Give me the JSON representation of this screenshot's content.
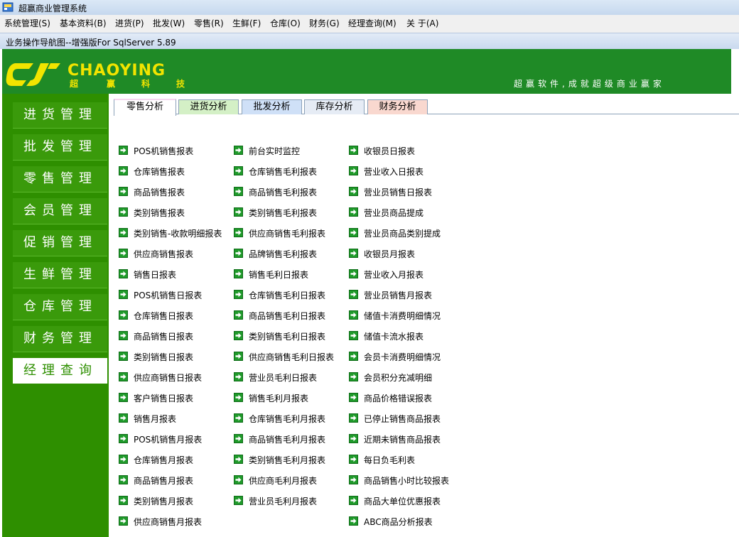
{
  "window": {
    "title": "超赢商业管理系统"
  },
  "menu": [
    "系统管理(S)",
    "基本资料(B)",
    "进货(P)",
    "批发(W)",
    "零售(R)",
    "生鲜(F)",
    "仓库(O)",
    "财务(G)",
    "经理查询(M)",
    "关 于(A)"
  ],
  "child_window": {
    "title": "业务操作导航图--增强版For SqlServer 5.89"
  },
  "banner": {
    "logo_text": "CHAOYING",
    "logo_sub": [
      "超",
      "赢",
      "科",
      "技"
    ],
    "slogan": "超赢软件,成就超级商业赢家"
  },
  "sidebar": {
    "items": [
      "进货管理",
      "批发管理",
      "零售管理",
      "会员管理",
      "促销管理",
      "生鲜管理",
      "仓库管理",
      "财务管理",
      "经理查询"
    ],
    "active_index": 8
  },
  "tabs": {
    "items": [
      {
        "label": "零售分析",
        "color": "#f7d6ef"
      },
      {
        "label": "进货分析",
        "color": "#d4f0c6"
      },
      {
        "label": "批发分析",
        "color": "#cfe0f7"
      },
      {
        "label": "库存分析",
        "color": "#e6ecf5"
      },
      {
        "label": "财务分析",
        "color": "#f9d8cf"
      }
    ],
    "active_index": 0
  },
  "reports": {
    "columns": [
      [
        "POS机销售报表",
        "仓库销售报表",
        "商品销售报表",
        "类别销售报表",
        "类别销售-收款明细报表",
        "供应商销售报表",
        "销售日报表",
        "POS机销售日报表",
        "仓库销售日报表",
        "商品销售日报表",
        "类别销售日报表",
        "供应商销售日报表",
        "客户销售日报表",
        "销售月报表",
        "POS机销售月报表",
        "仓库销售月报表",
        "商品销售月报表",
        "类别销售月报表",
        "供应商销售月报表"
      ],
      [
        "前台实时监控",
        "仓库销售毛利报表",
        "商品销售毛利报表",
        "类别销售毛利报表",
        "供应商销售毛利报表",
        "品牌销售毛利报表",
        "销售毛利日报表",
        "仓库销售毛利日报表",
        "商品销售毛利日报表",
        "类别销售毛利日报表",
        "供应商销售毛利日报表",
        "营业员毛利日报表",
        "销售毛利月报表",
        "仓库销售毛利月报表",
        "商品销售毛利月报表",
        "类别销售毛利月报表",
        "供应商毛利月报表",
        "营业员毛利月报表"
      ],
      [
        "收银员日报表",
        "营业收入日报表",
        "营业员销售日报表",
        "营业员商品提成",
        "营业员商品类别提成",
        "收银员月报表",
        "营业收入月报表",
        "营业员销售月报表",
        "储值卡消费明细情况",
        "储值卡流水报表",
        "会员卡消费明细情况",
        "会员积分充减明细",
        "商品价格错误报表",
        "已停止销售商品报表",
        "近期未销售商品报表",
        "每日负毛利表",
        "商品销售小时比较报表",
        "商品大单位优惠报表",
        "ABC商品分析报表"
      ]
    ]
  },
  "colors": {
    "brand_green": "#1f8a26",
    "sidebar_green": "#2e8f00",
    "logo_yellow": "#f2e400"
  }
}
